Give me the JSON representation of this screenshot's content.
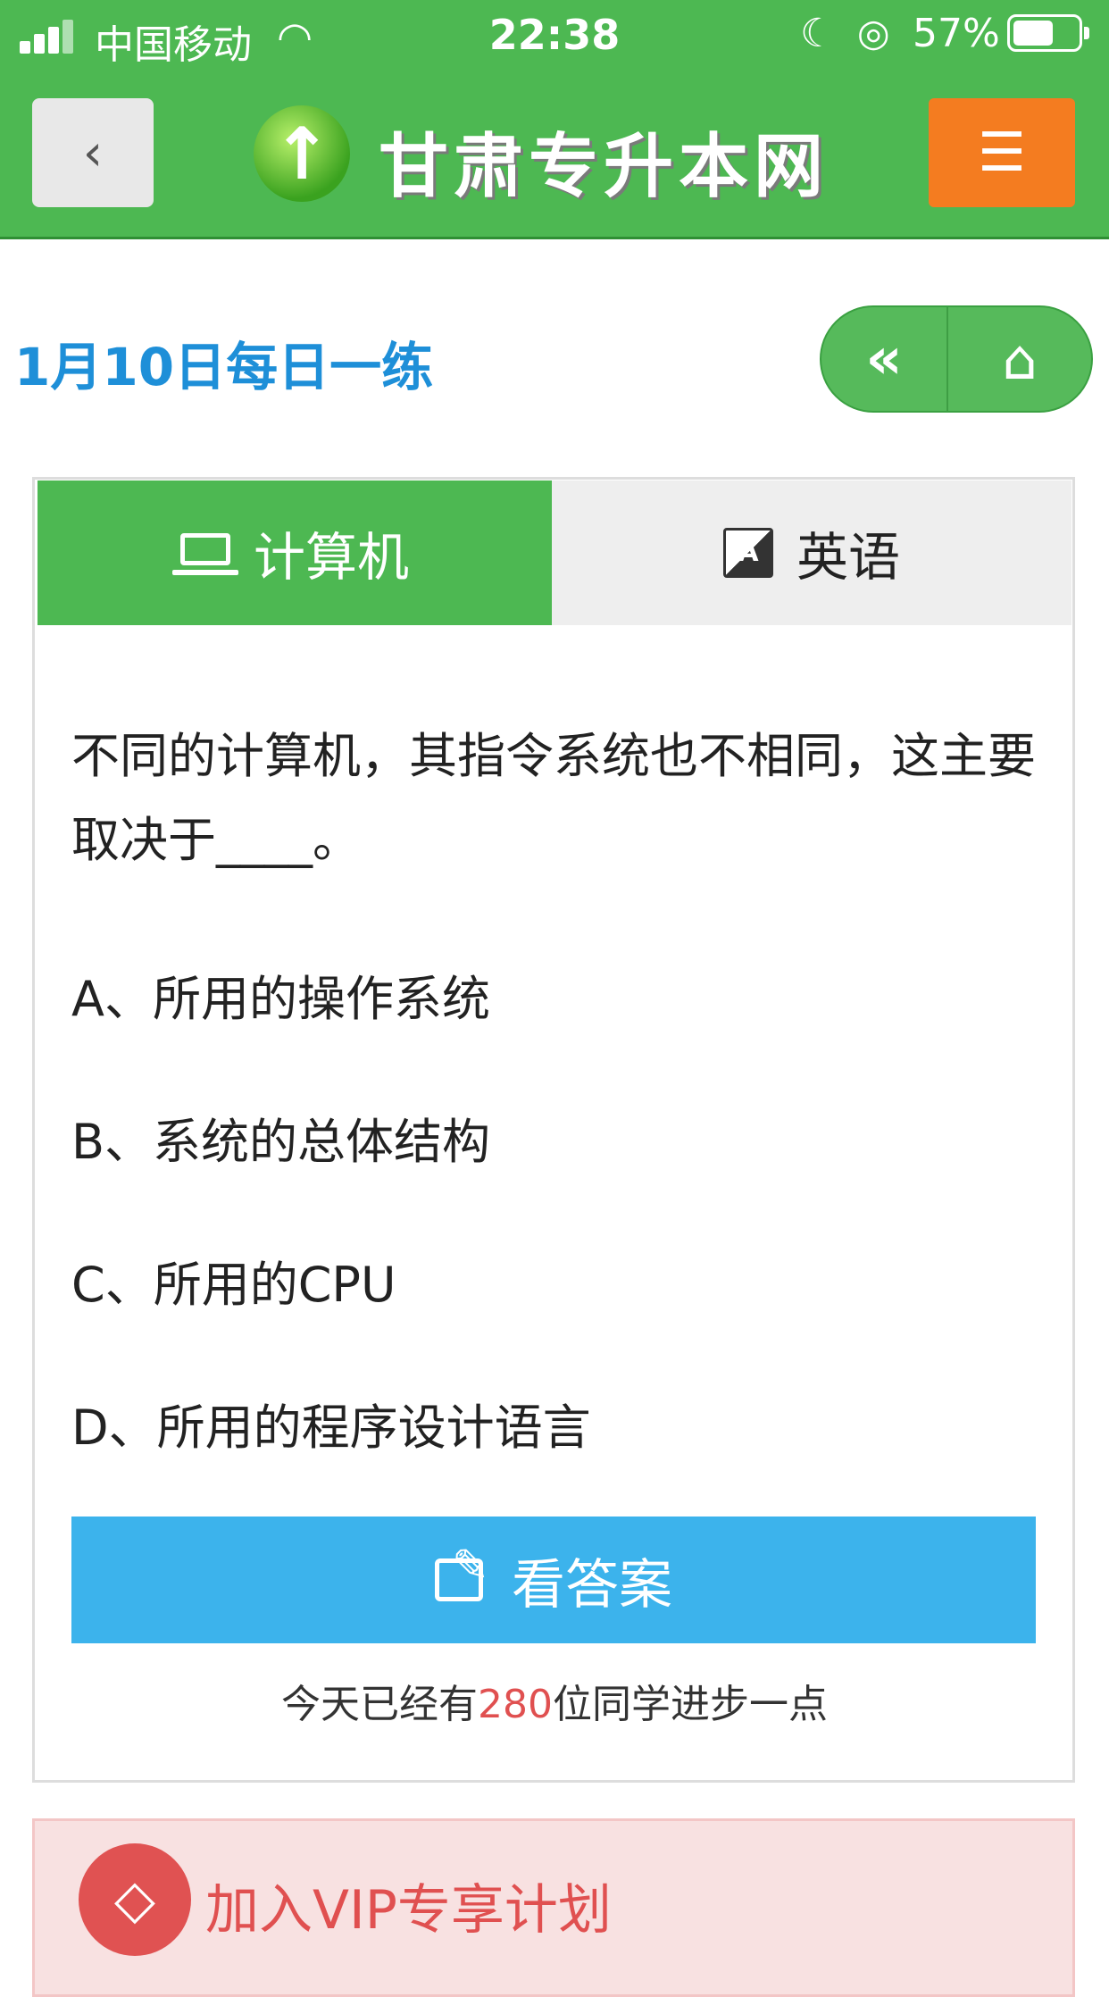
{
  "status_bar": {
    "carrier": "中国移动",
    "time": "22:38",
    "battery_percent": "57%",
    "battery_level": 0.57
  },
  "header": {
    "site_name": "甘肃专升本网",
    "back_icon": "chevron-left-icon",
    "menu_icon": "hamburger-icon"
  },
  "page": {
    "title": "1月10日每日一练",
    "prev_icon": "double-chevron-left-icon",
    "home_icon": "home-icon"
  },
  "tabs": [
    {
      "label": "计算机",
      "icon": "laptop-icon",
      "active": true
    },
    {
      "label": "英语",
      "icon": "translate-icon",
      "active": false
    }
  ],
  "question": {
    "text": "不同的计算机，其指令系统也不相同，这主要取决于____。",
    "options": [
      "A、所用的操作系统",
      "B、系统的总体结构",
      "C、所用的CPU",
      "D、所用的程序设计语言"
    ]
  },
  "answer_button": {
    "label": "看答案",
    "icon": "edit-icon"
  },
  "stats": {
    "prefix": "今天已经有",
    "count": "280",
    "suffix": "位同学进步一点"
  },
  "vip": {
    "label": "加入VIP专享计划",
    "icon": "diamond-icon"
  },
  "colors": {
    "header_green": "#4db852",
    "menu_orange": "#f47c20",
    "title_blue": "#1e8fd8",
    "answer_blue": "#3cb3ec",
    "accent_red": "#e05050"
  }
}
